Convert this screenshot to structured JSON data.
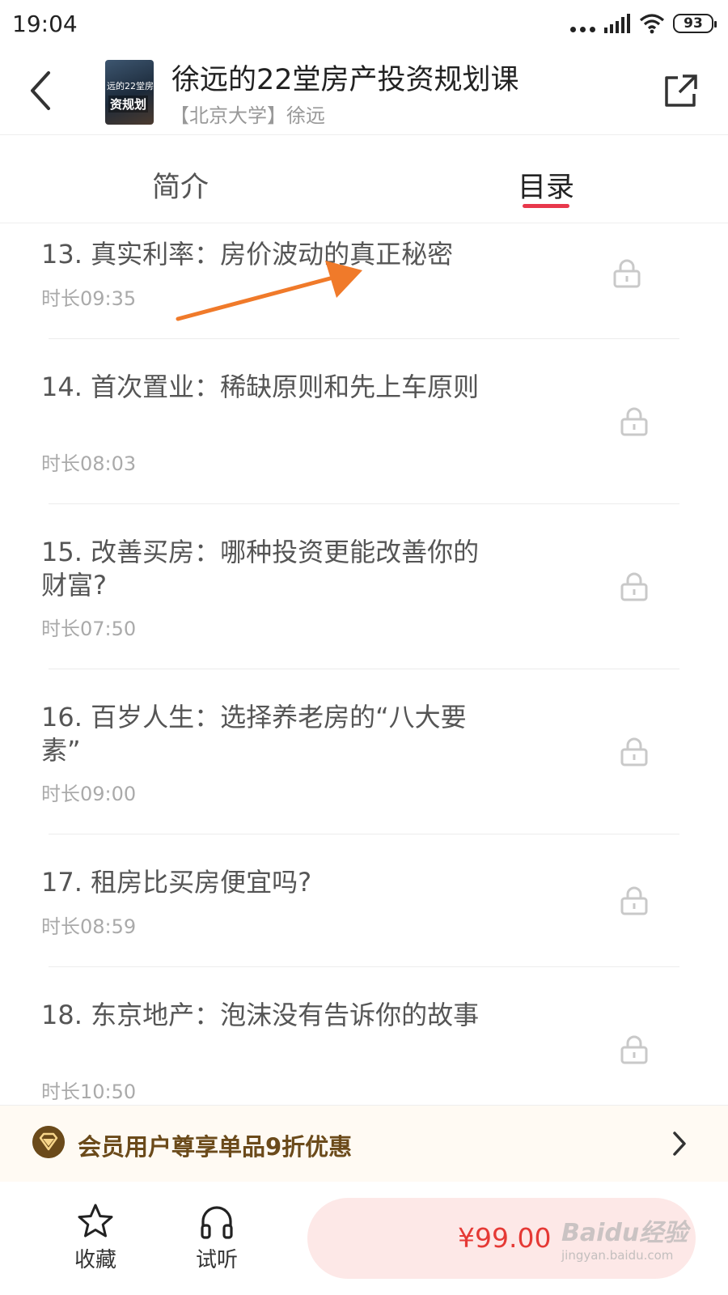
{
  "status_bar": {
    "time": "19:04",
    "battery": "93"
  },
  "header": {
    "course_title": "徐远的22堂房产投资规划课",
    "course_subtitle": "【北京大学】徐远",
    "cover_text_top": "远的22堂房",
    "cover_text_bottom": "资规划"
  },
  "tabs": [
    {
      "label": "简介",
      "active": false
    },
    {
      "label": "目录",
      "active": true
    }
  ],
  "accent_color": "#e8384b",
  "lessons": [
    {
      "title": "13. 真实利率：房价波动的真正秘密",
      "duration": "时长09:35",
      "locked": true
    },
    {
      "title": "14. 首次置业：稀缺原则和先上车原则",
      "duration": "时长08:03",
      "locked": true
    },
    {
      "title": "15. 改善买房：哪种投资更能改善你的财富?",
      "duration": "时长07:50",
      "locked": true
    },
    {
      "title": "16. 百岁人生：选择养老房的“八大要素”",
      "duration": "时长09:00",
      "locked": true
    },
    {
      "title": "17. 租房比买房便宜吗?",
      "duration": "时长08:59",
      "locked": true
    },
    {
      "title": "18. 东京地产：泡沫没有告诉你的故事",
      "duration": "时长10:50",
      "locked": true
    }
  ],
  "member_banner": {
    "text": "会员用户尊享单品9折优惠",
    "icon": "vip-diamond-icon"
  },
  "bottom_bar": {
    "favorite_label": "收藏",
    "listen_label": "试听",
    "price": "¥99.00"
  },
  "watermark": {
    "brand": "Baidu经验",
    "url": "jingyan.baidu.com"
  }
}
